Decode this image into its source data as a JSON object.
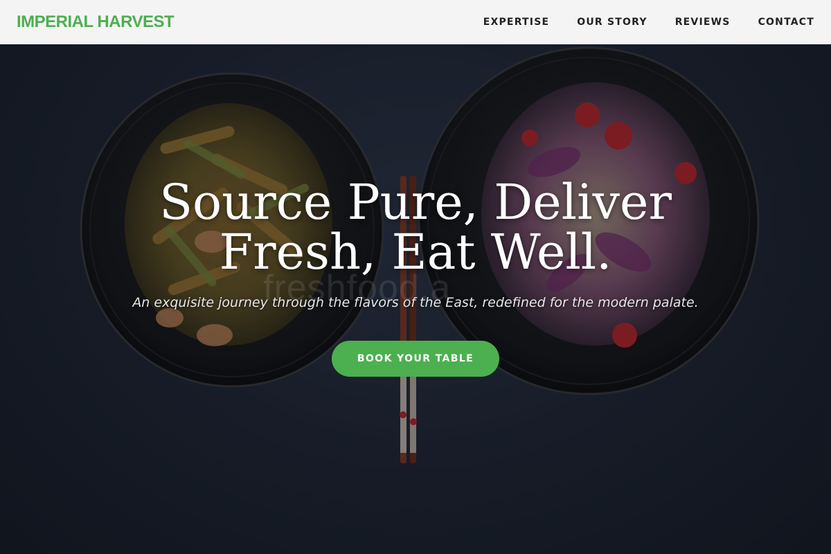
{
  "brand": {
    "name": "IMPERIAL HARVEST",
    "color": "#4caf50"
  },
  "nav": {
    "items": [
      {
        "label": "EXPERTISE"
      },
      {
        "label": "OUR STORY"
      },
      {
        "label": "REVIEWS"
      },
      {
        "label": "CONTACT"
      }
    ]
  },
  "hero": {
    "title_line1": "Source Pure, Deliver",
    "title_line2": "Fresh, Eat Well.",
    "subtitle": "An exquisite journey through the flavors of the East, redefined for the modern palate.",
    "cta_label": "BOOK YOUR TABLE",
    "watermark": "freshfood.a",
    "image": "two black bowls of stir-fried vegetables with shrimp and cabbage salad with chopsticks on dark slate"
  }
}
